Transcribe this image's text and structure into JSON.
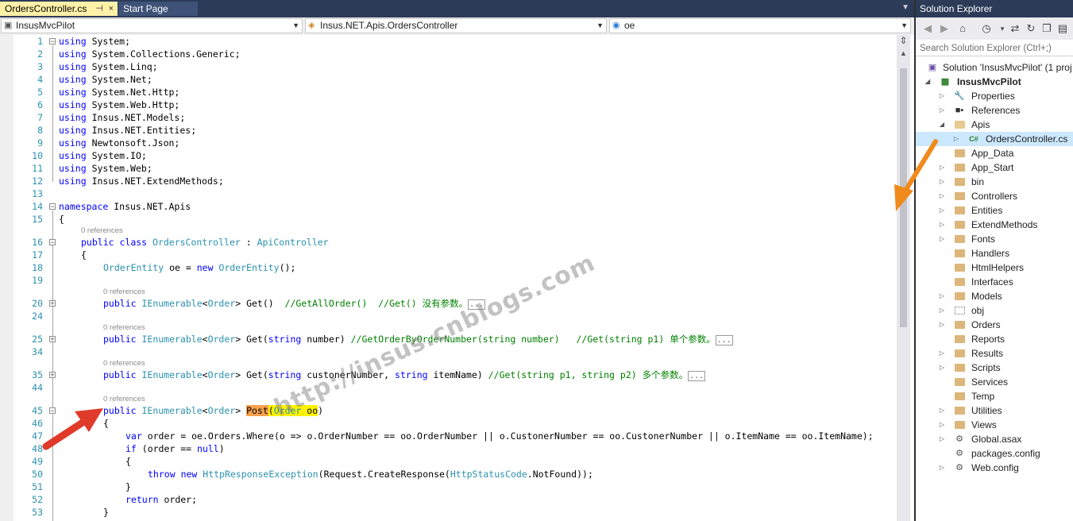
{
  "tabs": [
    {
      "label": "OrdersController.cs",
      "pin": "⊣",
      "close": "×"
    },
    {
      "label": "Start Page"
    }
  ],
  "navbar": {
    "project": "InsusMvcPilot",
    "class": "Insus.NET.Apis.OrdersController",
    "member": "oe"
  },
  "editor": {
    "lines": [
      {
        "n": "1"
      },
      {
        "n": "2"
      },
      {
        "n": "3"
      },
      {
        "n": "4"
      },
      {
        "n": "5"
      },
      {
        "n": "6"
      },
      {
        "n": "7"
      },
      {
        "n": "8"
      },
      {
        "n": "9"
      },
      {
        "n": "10"
      },
      {
        "n": "11"
      },
      {
        "n": "12"
      },
      {
        "n": "13"
      },
      {
        "n": "14"
      },
      {
        "n": "15"
      },
      {
        "n": "16"
      },
      {
        "n": "17"
      },
      {
        "n": "18"
      },
      {
        "n": "19"
      },
      {
        "n": "20"
      },
      {
        "n": "24"
      },
      {
        "n": "25"
      },
      {
        "n": "34"
      },
      {
        "n": "35"
      },
      {
        "n": "44"
      },
      {
        "n": "45"
      },
      {
        "n": "46"
      },
      {
        "n": "47"
      },
      {
        "n": "48"
      },
      {
        "n": "49"
      },
      {
        "n": "50"
      },
      {
        "n": "51"
      },
      {
        "n": "52"
      },
      {
        "n": "53"
      }
    ],
    "usings": [
      "System",
      "System.Collections.Generic",
      "System.Linq",
      "System.Net",
      "System.Net.Http",
      "System.Web.Http",
      "Insus.NET.Models",
      "Insus.NET.Entities",
      "Newtonsoft.Json",
      "System.IO",
      "System.Web",
      "Insus.NET.ExtendMethods"
    ],
    "kw_using": "using",
    "kw_namespace": "namespace",
    "namespace_name": " Insus.NET.Apis",
    "open_brace": "{",
    "close_brace": "}",
    "lens": "0 references",
    "class_decl": {
      "kw1": "public",
      "kw2": " class ",
      "name": "OrdersController",
      "sep": " : ",
      "base": "ApiController"
    },
    "field_line": {
      "type": "OrderEntity",
      "mid": " oe = ",
      "kw": "new",
      "type2": " OrderEntity",
      "end": "();"
    },
    "m1": {
      "kw": "public",
      "t1": " IEnumerable",
      "lt": "<",
      "t2": "Order",
      "gt": ">",
      "rest": " Get()  ",
      "comment": "//GetAllOrder()  //Get() 没有参数。",
      "ellipsis": "..."
    },
    "m2": {
      "kw": "public",
      "t1": " IEnumerable",
      "lt": "<",
      "t2": "Order",
      "gt": ">",
      "pre": " Get(",
      "kw2": "string",
      "rest": " number) ",
      "comment": "//GetOrderByOrderNumber(string number)   //Get(string p1) 单个参数。",
      "ellipsis": "..."
    },
    "m3": {
      "kw": "public",
      "t1": " IEnumerable",
      "lt": "<",
      "t2": "Order",
      "gt": ">",
      "pre": " Get(",
      "kw2": "string",
      "mid": " custonerNumber, ",
      "kw3": "string",
      "rest": " itemName) ",
      "comment": "//Get(string p1, string p2) 多个参数。",
      "ellipsis": "..."
    },
    "m4": {
      "kw": "public",
      "t1": " IEnumerable",
      "lt": "<",
      "t2": "Order",
      "gt": ">",
      "sp": " ",
      "name": "Post",
      "paren": "(",
      "ptype": "Order",
      "pname": " oo",
      ")": ")"
    },
    "l47": {
      "kw": "var",
      "rest": " order = oe.Orders.Where(o => o.OrderNumber == oo.OrderNumber || o.CustonerNumber == oo.CustonerNumber || o.ItemName == oo.ItemName);"
    },
    "l48": {
      "kw": "if",
      "pre": " (order == ",
      "kw2": "null",
      "end": ")"
    },
    "l50": {
      "kw": "throw",
      "sp": " ",
      "kw2": "new",
      "t": " HttpResponseException",
      "mid": "(Request.CreateResponse(",
      "t2": "HttpStatusCode",
      "end": ".NotFound));"
    },
    "l52": {
      "kw": "return",
      "rest": " order;"
    }
  },
  "solution_explorer": {
    "title": "Solution Explorer",
    "search_placeholder": "Search Solution Explorer (Ctrl+;)",
    "items": [
      {
        "label": "Solution 'InsusMvcPilot' (1 proj"
      },
      {
        "label": "InsusMvcPilot"
      },
      {
        "label": "Properties"
      },
      {
        "label": "References"
      },
      {
        "label": "Apis"
      },
      {
        "label": "OrdersController.cs"
      },
      {
        "label": "App_Data"
      },
      {
        "label": "App_Start"
      },
      {
        "label": "bin"
      },
      {
        "label": "Controllers"
      },
      {
        "label": "Entities"
      },
      {
        "label": "ExtendMethods"
      },
      {
        "label": "Fonts"
      },
      {
        "label": "Handlers"
      },
      {
        "label": "HtmlHelpers"
      },
      {
        "label": "Interfaces"
      },
      {
        "label": "Models"
      },
      {
        "label": "obj"
      },
      {
        "label": "Orders"
      },
      {
        "label": "Reports"
      },
      {
        "label": "Results"
      },
      {
        "label": "Scripts"
      },
      {
        "label": "Services"
      },
      {
        "label": "Temp"
      },
      {
        "label": "Utilities"
      },
      {
        "label": "Views"
      },
      {
        "label": "Global.asax"
      },
      {
        "label": "packages.config"
      },
      {
        "label": "Web.config"
      }
    ]
  },
  "watermark": "http://insus.cnblogs.com",
  "colors": {
    "keyword": "#0000ff",
    "type": "#2b91af",
    "comment": "#008000",
    "arrow": "#e03a2a",
    "arrow2": "#f08a1c",
    "tab_active": "#fff1a8"
  }
}
